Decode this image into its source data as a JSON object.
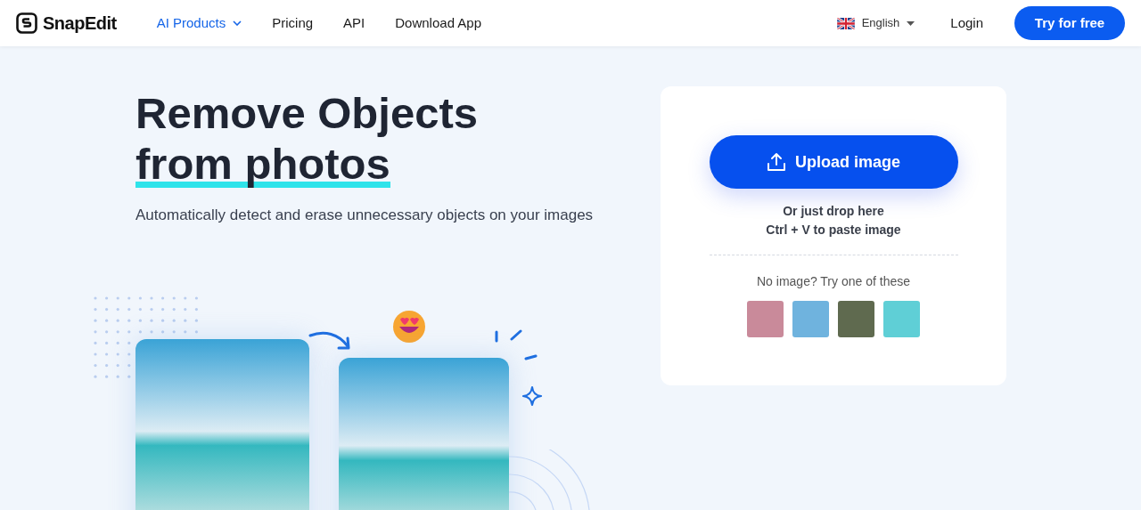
{
  "header": {
    "logo": "SnapEdit",
    "nav": [
      {
        "label": "AI Products",
        "selected": true,
        "dropdown": true
      },
      {
        "label": "Pricing",
        "selected": false,
        "dropdown": false
      },
      {
        "label": "API",
        "selected": false,
        "dropdown": false
      },
      {
        "label": "Download App",
        "selected": false,
        "dropdown": false
      }
    ],
    "language": "English",
    "login": "Login",
    "cta": "Try for free"
  },
  "hero": {
    "title_lines": [
      "Remove Objects",
      "from photos"
    ],
    "subtitle": "Automatically detect and erase unnecessary objects on your images"
  },
  "upload_card": {
    "button": "Upload image",
    "hint_lines": [
      "Or just drop here",
      "Ctrl + V to paste image"
    ],
    "samples_label": "No image? Try one of these",
    "samples": [
      {
        "color": "#c98a9a"
      },
      {
        "color": "#6fb3de"
      },
      {
        "color": "#5f6a4f"
      },
      {
        "color": "#5fcfd6"
      }
    ]
  }
}
